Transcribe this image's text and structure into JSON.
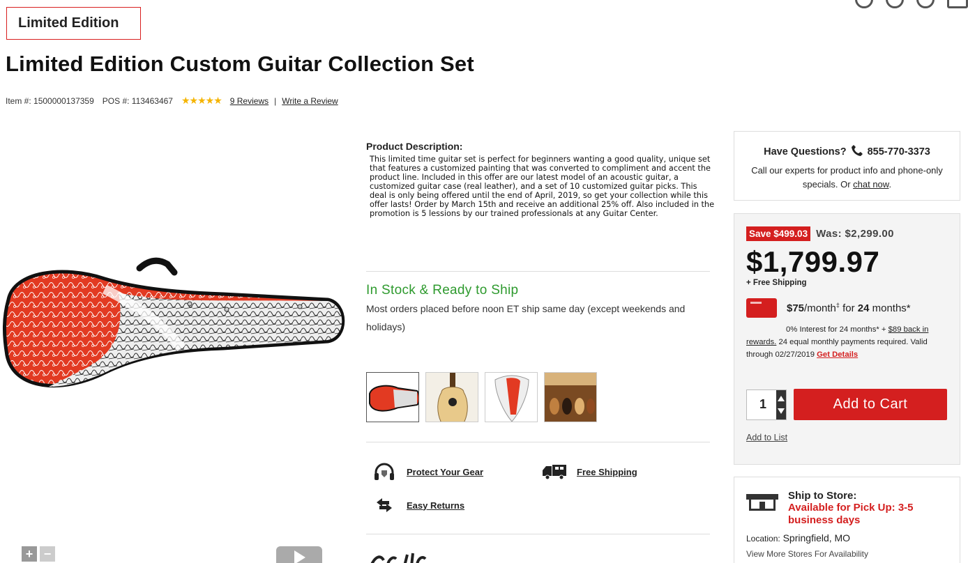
{
  "badge": "Limited Edition",
  "title": "Limited Edition Custom Guitar Collection Set",
  "meta": {
    "item": "Item #: 1500000137359",
    "pos": "POS #: 113463467",
    "stars": "★★★★★",
    "rating": 5,
    "reviews": "9 Reviews",
    "separator": "|",
    "write_review": "Write a Review"
  },
  "description": {
    "heading": "Product Description:",
    "body": "This limited time guitar set is perfect for beginners wanting a good quality, unique set that features a customized painting that was converted to compliment and accent the product line. Included in this offer are our latest model of an acoustic guitar, a customized guitar case (real leather), and a set of 10 customized guitar picks. This deal is only being offered until the end of April, 2019, so get your collection while this offer lasts! Order by March 15th and receive an additional 25% off. Also included in the promotion is 5 lessions by our trained professionals at any Guitar Center."
  },
  "stock": {
    "status": "In Stock & Ready to Ship",
    "note": "Most orders placed before noon ET ship same day (except weekends and holidays)"
  },
  "features": {
    "protect": "Protect Your Gear",
    "shipping": "Free Shipping",
    "returns": "Easy Returns"
  },
  "zoom": {
    "plus": "+",
    "minus": "−"
  },
  "questions": {
    "heading": "Have Questions?",
    "phone": "855-770-3373",
    "body_pre": "Call our experts for product info and phone-only specials. Or ",
    "chat": "chat now",
    "body_post": "."
  },
  "pricing": {
    "save": "Save $499.03",
    "was": "Was: $2,299.00",
    "price": "$1,799.97",
    "free_shipping": "+ Free Shipping",
    "monthly_amount": "$75",
    "monthly_unit": "/month",
    "monthly_mark": "‡",
    "monthly_for": " for ",
    "monthly_months": "24",
    "monthly_suffix": " months*",
    "fin_line1": "0% Interest for 24 months* + ",
    "fin_link": "$89 back in rewards.",
    "fin_line2": " 24 equal monthly payments required. Valid through 02/27/2019 ",
    "get_details": "Get Details",
    "quantity": "1",
    "add_to_cart": "Add to Cart",
    "add_to_list": "Add to List"
  },
  "ship_store": {
    "title": "Ship to Store:",
    "availability": "Available for Pick Up: 3-5 business days",
    "location_label": "Location:",
    "location": "Springfield, MO",
    "more": "View More Stores For Availability"
  },
  "colors": {
    "accent_red": "#d41f1f",
    "stock_green": "#2e9a2e",
    "star_gold": "#f5b400"
  }
}
